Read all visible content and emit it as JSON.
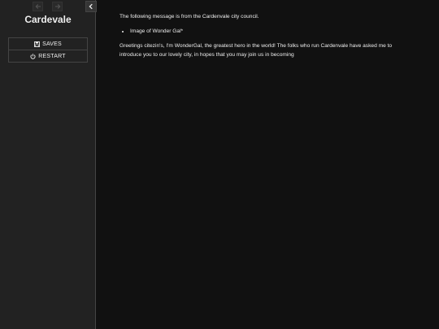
{
  "story": {
    "title": "Cardevale"
  },
  "menu": {
    "saves_label": "SAVES",
    "restart_label": "RESTART"
  },
  "icons": {
    "history_back": "arrow-left-icon",
    "history_forward": "arrow-right-icon",
    "toggle": "chevron-left-icon",
    "saves": "floppy-disk-icon",
    "restart": "power-icon"
  },
  "passage": {
    "intro": "The following message is from the Cardenvale city council.",
    "list_items": [
      "Image of Wonder Gal*"
    ],
    "greeting": "Greetings citezin's, I'm WonderGal, the greatest hero in the world! The folks who run Cardenvale have asked me to introduce you to our lovely city, in hopes that you may join us in becoming"
  },
  "colors": {
    "sidebar_bg": "#222222",
    "main_bg": "#111111",
    "text": "#eeeeee",
    "border": "#444444"
  }
}
